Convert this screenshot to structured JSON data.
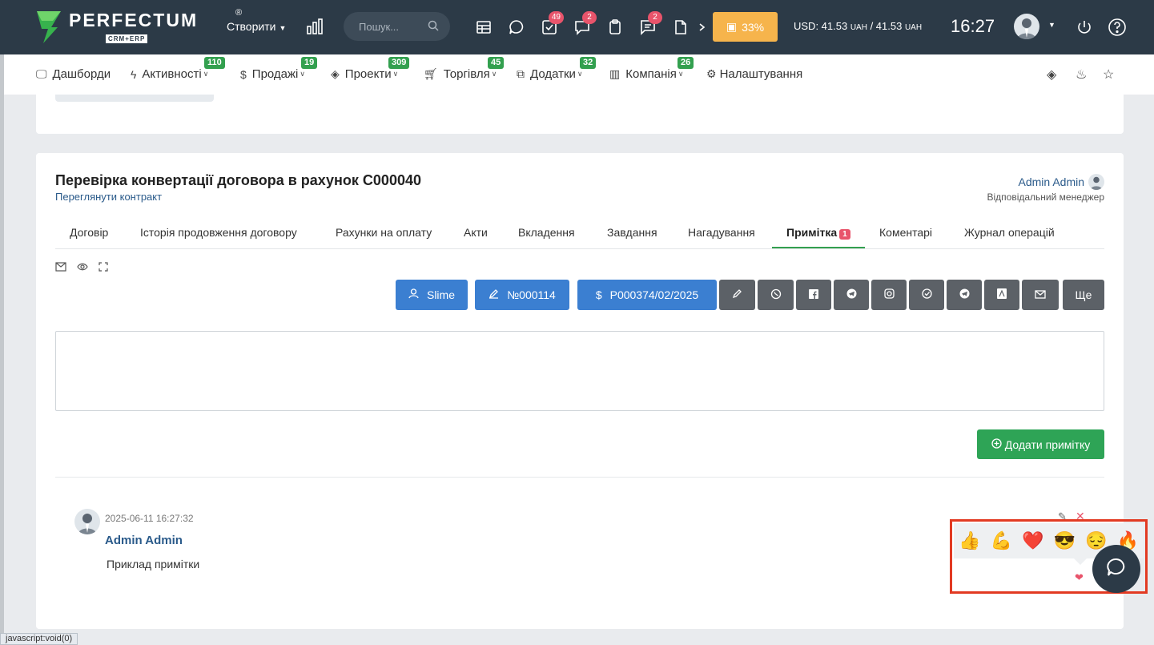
{
  "topbar": {
    "logo": {
      "name": "PERFECTUM",
      "reg": "®",
      "sub": "CRM+ERP"
    },
    "create_label": "Створити",
    "search_placeholder": "Пошук...",
    "badges": {
      "tasks": "49",
      "chat": "2",
      "messages": "2"
    },
    "progress_label": "33%",
    "rate_prefix": "USD: 41.53",
    "rate_unit1": "UAH",
    "rate_mid": " / 41.53",
    "rate_unit2": "UAH",
    "time": "16:27"
  },
  "nav": {
    "items": [
      {
        "label": "Дашборди",
        "badge": ""
      },
      {
        "label": "Активності",
        "badge": "110"
      },
      {
        "label": "Продажі",
        "badge": "19"
      },
      {
        "label": "Проекти",
        "badge": "309"
      },
      {
        "label": "Торгівля",
        "badge": "45"
      },
      {
        "label": "Додатки",
        "badge": "32"
      },
      {
        "label": "Компанія",
        "badge": "26"
      },
      {
        "label": "Налаштування",
        "badge": ""
      }
    ]
  },
  "page": {
    "title": "Перевірка конвертації договора в рахунок C000040",
    "view_contract": "Переглянути контракт",
    "manager_name": "Admin Admin",
    "manager_role": "Відповідальний менеджер"
  },
  "tabs": [
    {
      "label": "Договір"
    },
    {
      "label": "Історія продовження договору"
    },
    {
      "label": "Рахунки на оплату"
    },
    {
      "label": "Акти"
    },
    {
      "label": "Вкладення"
    },
    {
      "label": "Завдання"
    },
    {
      "label": "Нагадування"
    },
    {
      "label": "Примітка",
      "badge": "1"
    },
    {
      "label": "Коментарі"
    },
    {
      "label": "Журнал операцій"
    }
  ],
  "actions": {
    "client": "Slime",
    "number": "№000114",
    "invoice": "P000374/02/2025",
    "more": "Ще"
  },
  "note": {
    "add_label": "Додати примітку"
  },
  "comment": {
    "date": "2025-06-11 16:27:32",
    "author": "Admin Admin",
    "text": "Приклад примітки"
  },
  "reactions": [
    "👍",
    "💪",
    "❤️",
    "😎",
    "😔",
    "🔥"
  ],
  "status": "javascript:void(0)",
  "colors": {
    "topbar": "#2c3a47",
    "accent_green": "#33a04f",
    "blue": "#3b7fd1",
    "badge_red": "#e8546b",
    "progress": "#f6b44c"
  }
}
